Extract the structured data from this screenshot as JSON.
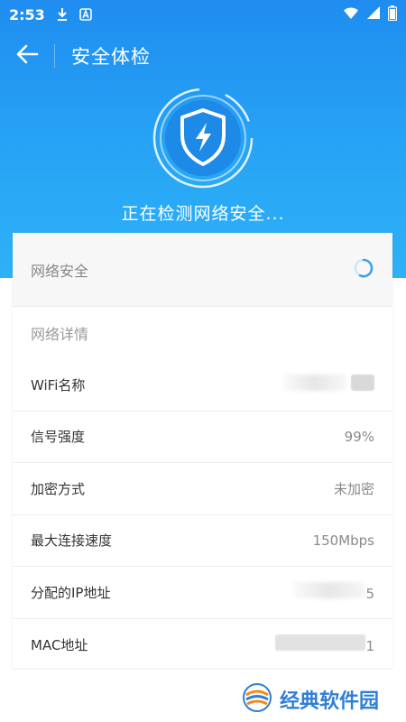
{
  "statusbar": {
    "time": "2:53",
    "icons": [
      "download-icon",
      "a-icon",
      "wifi-icon",
      "signal-icon",
      "battery-icon"
    ]
  },
  "toolbar": {
    "title": "安全体检",
    "back_icon": "arrow-left-icon"
  },
  "hero": {
    "shield_icon": "shield-lightning-icon",
    "scan_text": "正在检测网络安全..."
  },
  "network_security": {
    "label": "网络安全",
    "status_icon": "loading-spinner-icon"
  },
  "details": {
    "title": "网络详情",
    "rows": [
      {
        "key": "WiFi名称",
        "value": ""
      },
      {
        "key": "信号强度",
        "value": "99%"
      },
      {
        "key": "加密方式",
        "value": "未加密"
      },
      {
        "key": "最大连接速度",
        "value": "150Mbps"
      },
      {
        "key": "分配的IP地址",
        "value": "5"
      },
      {
        "key": "MAC地址",
        "value": "1"
      }
    ]
  },
  "watermark": {
    "text": "经典软件园"
  },
  "colors": {
    "primary": "#1f8df0",
    "accent_light": "#2eb1f7"
  }
}
